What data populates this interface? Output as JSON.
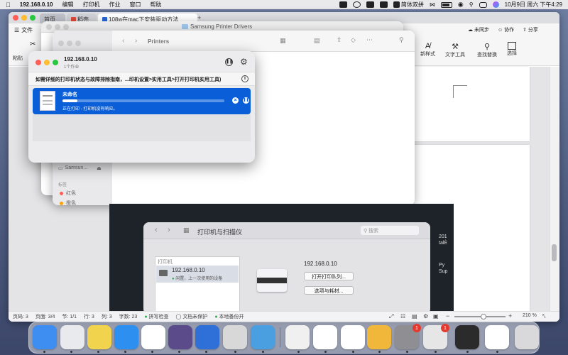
{
  "menubar": {
    "app": "192.168.0.10",
    "items": [
      "编辑",
      "打印机",
      "作业",
      "窗口",
      "帮助"
    ],
    "input_method": "简体双拼",
    "datetime": "10月9日 周六 下午4:29",
    "right_app": "the Do..."
  },
  "wps": {
    "tabs": [
      {
        "label": "首页"
      },
      {
        "label": "稻壳"
      },
      {
        "label": "108w在mac下安装驱动方法"
      }
    ],
    "menu_label": "文件",
    "cloud_sync": "未同步",
    "collab": "协作",
    "share": "分享",
    "paste": "粘贴",
    "new_style": "新样式",
    "text_tools": "文字工具",
    "find_replace": "查找替换",
    "select": "选择",
    "status": {
      "page_num": "页码: 3",
      "pages": "页面: 3/4",
      "section": "节: 1/1",
      "row": "行: 3",
      "col": "列: 3",
      "words": "字数: 23",
      "spell": "拼写检查",
      "doc_protect": "文档未保护",
      "backup": "本地备份开",
      "zoom": "210 %"
    }
  },
  "finder_back": {
    "title": "Samsung Printer Drivers"
  },
  "finder_front": {
    "title": "Printers",
    "sidebar": {
      "device": "Samsun...",
      "tags_header": "标签",
      "tags": [
        {
          "name": "红色",
          "color": "#ff5f57"
        },
        {
          "name": "橙色",
          "color": "#ff9f0a"
        }
      ]
    }
  },
  "print_queue": {
    "printer": "192.168.0.10",
    "job_count": "1个作业",
    "help_text": "如需详细的打印机状态与故障排除指南，...印机设置>实用工具>打开打印机实用工具)",
    "job": {
      "name": "未命名",
      "status": "正在打印 - 打印机没有响应。",
      "progress": 0.09
    }
  },
  "photo": {
    "title": "打印机与扫描仪",
    "search_placeholder": "搜索",
    "list_header": "打印机",
    "printer": {
      "name": "192.168.0.10",
      "status": "闲置，上一次使用的设备"
    },
    "detail_name": "192.168.0.10",
    "open_queue": "打开打印队列...",
    "options": "选项与耗材...",
    "right_texts": [
      "201",
      "talÈ",
      "Py",
      "Sup"
    ]
  },
  "dock": {
    "apps": [
      {
        "name": "Finder",
        "color": "#3d8ef0"
      },
      {
        "name": "Launchpad",
        "color": "#e9eaee"
      },
      {
        "name": "Stickies",
        "color": "#f2d34e"
      },
      {
        "name": "Safari",
        "color": "#2d8ff0"
      },
      {
        "name": "Notion",
        "color": "#ffffff"
      },
      {
        "name": "Marker",
        "color": "#5b4b8a"
      },
      {
        "name": "Dictionary",
        "color": "#2f6fd8"
      },
      {
        "name": "Printer",
        "color": "#d8d8d8"
      },
      {
        "name": "Transporter",
        "color": "#4a9fe0"
      },
      {
        "name": "Pages",
        "color": "#f0f0f0"
      },
      {
        "name": "Baidu Netdisk",
        "color": "#ffffff"
      },
      {
        "name": "WPS Office",
        "color": "#ffffff"
      },
      {
        "name": "Archive Utility",
        "color": "#f0b73a"
      },
      {
        "name": "System Preferences",
        "color": "#8e8e93",
        "badge": "1"
      },
      {
        "name": "Printer Queue",
        "color": "#e6e6e6",
        "badge": "1"
      },
      {
        "name": "Screen",
        "color": "#2b2b2b"
      },
      {
        "name": "Photos",
        "color": "#ffffff"
      },
      {
        "name": "Trash",
        "color": "#d9d9dc"
      }
    ]
  }
}
